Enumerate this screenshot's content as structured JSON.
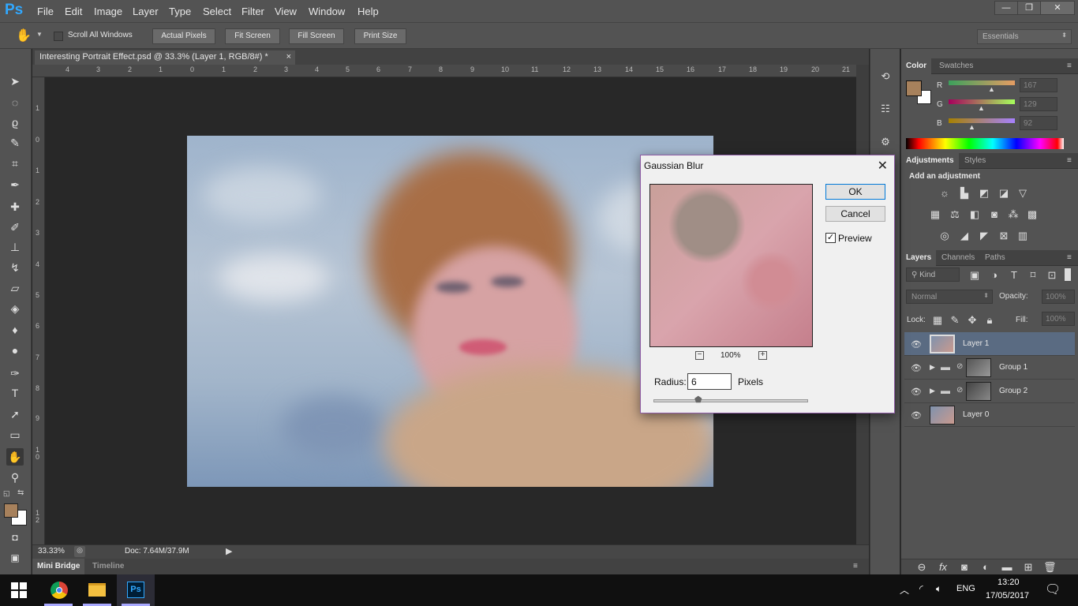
{
  "app": {
    "logo": "Ps",
    "menu": [
      "File",
      "Edit",
      "Image",
      "Layer",
      "Type",
      "Select",
      "Filter",
      "View",
      "Window",
      "Help"
    ],
    "window_controls": {
      "minimize": "—",
      "restore": "❐",
      "close": "✕"
    }
  },
  "options_bar": {
    "tool_icon": "hand-icon",
    "scroll_all_windows": "Scroll All Windows",
    "buttons": [
      "Actual Pixels",
      "Fit Screen",
      "Fill Screen",
      "Print Size"
    ],
    "workspace": "Essentials"
  },
  "document": {
    "tab_title": "Interesting Portrait Effect.psd @ 33.3% (Layer 1, RGB/8#) *",
    "tab_close": "×",
    "ruler_h_labels": [
      "4",
      "3",
      "2",
      "1",
      "0",
      "1",
      "2",
      "3",
      "4",
      "5",
      "6",
      "7",
      "8",
      "9",
      "10",
      "11",
      "12",
      "13",
      "14",
      "15",
      "16",
      "17",
      "18",
      "19",
      "20",
      "21"
    ],
    "ruler_v_labels": [
      "1",
      "0",
      "1",
      "2",
      "3",
      "4",
      "5",
      "6",
      "7",
      "8",
      "9",
      "1 0",
      "1 1",
      "1 2"
    ],
    "zoom": "33.33%",
    "doc_info": "Doc: 7.64M/37.9M"
  },
  "bottom_tabs": {
    "mini_bridge": "Mini Bridge",
    "timeline": "Timeline"
  },
  "color_panel": {
    "tabs": [
      "Color",
      "Swatches"
    ],
    "channels": [
      {
        "label": "R",
        "value": "167"
      },
      {
        "label": "G",
        "value": "129"
      },
      {
        "label": "B",
        "value": "92"
      }
    ],
    "foreground": "#a7815c"
  },
  "adjustments_panel": {
    "tabs": [
      "Adjustments",
      "Styles"
    ],
    "heading": "Add an adjustment"
  },
  "layers_panel": {
    "tabs": [
      "Layers",
      "Channels",
      "Paths"
    ],
    "kind": "Kind",
    "blend_mode": "Normal",
    "opacity_label": "Opacity:",
    "opacity": "100%",
    "lock_label": "Lock:",
    "fill_label": "Fill:",
    "fill": "100%",
    "layers": [
      "Layer 1",
      "Group 1",
      "Group 2",
      "Layer 0"
    ]
  },
  "dialog": {
    "title": "Gaussian Blur",
    "ok": "OK",
    "cancel": "Cancel",
    "preview_label": "Preview",
    "zoom": "100%",
    "radius_label": "Radius:",
    "radius_value": "6",
    "unit": "Pixels"
  },
  "taskbar": {
    "language": "ENG",
    "time": "13:20",
    "date": "17/05/2017"
  }
}
